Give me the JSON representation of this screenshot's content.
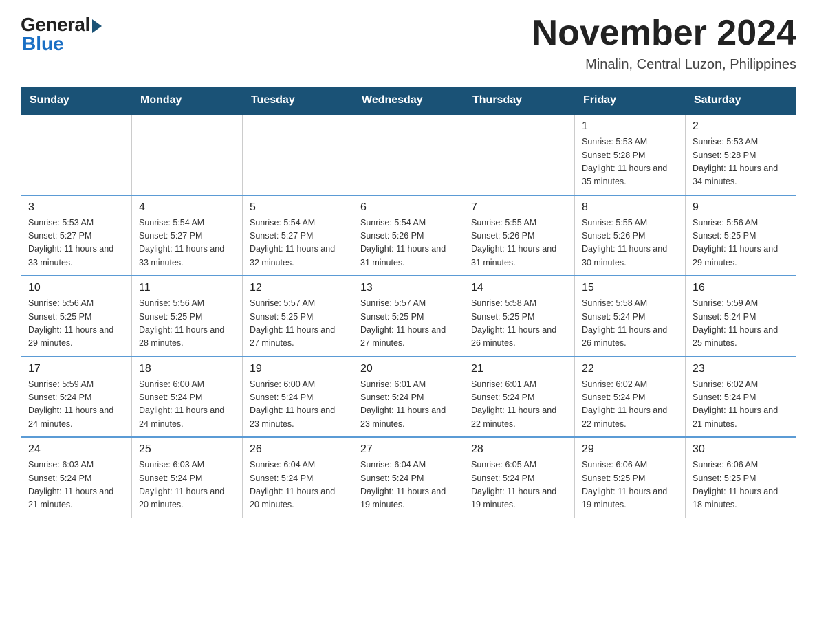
{
  "header": {
    "logo_general": "General",
    "logo_blue": "Blue",
    "month_title": "November 2024",
    "location": "Minalin, Central Luzon, Philippines"
  },
  "days_of_week": [
    "Sunday",
    "Monday",
    "Tuesday",
    "Wednesday",
    "Thursday",
    "Friday",
    "Saturday"
  ],
  "weeks": [
    [
      {
        "day": "",
        "info": ""
      },
      {
        "day": "",
        "info": ""
      },
      {
        "day": "",
        "info": ""
      },
      {
        "day": "",
        "info": ""
      },
      {
        "day": "",
        "info": ""
      },
      {
        "day": "1",
        "info": "Sunrise: 5:53 AM\nSunset: 5:28 PM\nDaylight: 11 hours and 35 minutes."
      },
      {
        "day": "2",
        "info": "Sunrise: 5:53 AM\nSunset: 5:28 PM\nDaylight: 11 hours and 34 minutes."
      }
    ],
    [
      {
        "day": "3",
        "info": "Sunrise: 5:53 AM\nSunset: 5:27 PM\nDaylight: 11 hours and 33 minutes."
      },
      {
        "day": "4",
        "info": "Sunrise: 5:54 AM\nSunset: 5:27 PM\nDaylight: 11 hours and 33 minutes."
      },
      {
        "day": "5",
        "info": "Sunrise: 5:54 AM\nSunset: 5:27 PM\nDaylight: 11 hours and 32 minutes."
      },
      {
        "day": "6",
        "info": "Sunrise: 5:54 AM\nSunset: 5:26 PM\nDaylight: 11 hours and 31 minutes."
      },
      {
        "day": "7",
        "info": "Sunrise: 5:55 AM\nSunset: 5:26 PM\nDaylight: 11 hours and 31 minutes."
      },
      {
        "day": "8",
        "info": "Sunrise: 5:55 AM\nSunset: 5:26 PM\nDaylight: 11 hours and 30 minutes."
      },
      {
        "day": "9",
        "info": "Sunrise: 5:56 AM\nSunset: 5:25 PM\nDaylight: 11 hours and 29 minutes."
      }
    ],
    [
      {
        "day": "10",
        "info": "Sunrise: 5:56 AM\nSunset: 5:25 PM\nDaylight: 11 hours and 29 minutes."
      },
      {
        "day": "11",
        "info": "Sunrise: 5:56 AM\nSunset: 5:25 PM\nDaylight: 11 hours and 28 minutes."
      },
      {
        "day": "12",
        "info": "Sunrise: 5:57 AM\nSunset: 5:25 PM\nDaylight: 11 hours and 27 minutes."
      },
      {
        "day": "13",
        "info": "Sunrise: 5:57 AM\nSunset: 5:25 PM\nDaylight: 11 hours and 27 minutes."
      },
      {
        "day": "14",
        "info": "Sunrise: 5:58 AM\nSunset: 5:25 PM\nDaylight: 11 hours and 26 minutes."
      },
      {
        "day": "15",
        "info": "Sunrise: 5:58 AM\nSunset: 5:24 PM\nDaylight: 11 hours and 26 minutes."
      },
      {
        "day": "16",
        "info": "Sunrise: 5:59 AM\nSunset: 5:24 PM\nDaylight: 11 hours and 25 minutes."
      }
    ],
    [
      {
        "day": "17",
        "info": "Sunrise: 5:59 AM\nSunset: 5:24 PM\nDaylight: 11 hours and 24 minutes."
      },
      {
        "day": "18",
        "info": "Sunrise: 6:00 AM\nSunset: 5:24 PM\nDaylight: 11 hours and 24 minutes."
      },
      {
        "day": "19",
        "info": "Sunrise: 6:00 AM\nSunset: 5:24 PM\nDaylight: 11 hours and 23 minutes."
      },
      {
        "day": "20",
        "info": "Sunrise: 6:01 AM\nSunset: 5:24 PM\nDaylight: 11 hours and 23 minutes."
      },
      {
        "day": "21",
        "info": "Sunrise: 6:01 AM\nSunset: 5:24 PM\nDaylight: 11 hours and 22 minutes."
      },
      {
        "day": "22",
        "info": "Sunrise: 6:02 AM\nSunset: 5:24 PM\nDaylight: 11 hours and 22 minutes."
      },
      {
        "day": "23",
        "info": "Sunrise: 6:02 AM\nSunset: 5:24 PM\nDaylight: 11 hours and 21 minutes."
      }
    ],
    [
      {
        "day": "24",
        "info": "Sunrise: 6:03 AM\nSunset: 5:24 PM\nDaylight: 11 hours and 21 minutes."
      },
      {
        "day": "25",
        "info": "Sunrise: 6:03 AM\nSunset: 5:24 PM\nDaylight: 11 hours and 20 minutes."
      },
      {
        "day": "26",
        "info": "Sunrise: 6:04 AM\nSunset: 5:24 PM\nDaylight: 11 hours and 20 minutes."
      },
      {
        "day": "27",
        "info": "Sunrise: 6:04 AM\nSunset: 5:24 PM\nDaylight: 11 hours and 19 minutes."
      },
      {
        "day": "28",
        "info": "Sunrise: 6:05 AM\nSunset: 5:24 PM\nDaylight: 11 hours and 19 minutes."
      },
      {
        "day": "29",
        "info": "Sunrise: 6:06 AM\nSunset: 5:25 PM\nDaylight: 11 hours and 19 minutes."
      },
      {
        "day": "30",
        "info": "Sunrise: 6:06 AM\nSunset: 5:25 PM\nDaylight: 11 hours and 18 minutes."
      }
    ]
  ]
}
